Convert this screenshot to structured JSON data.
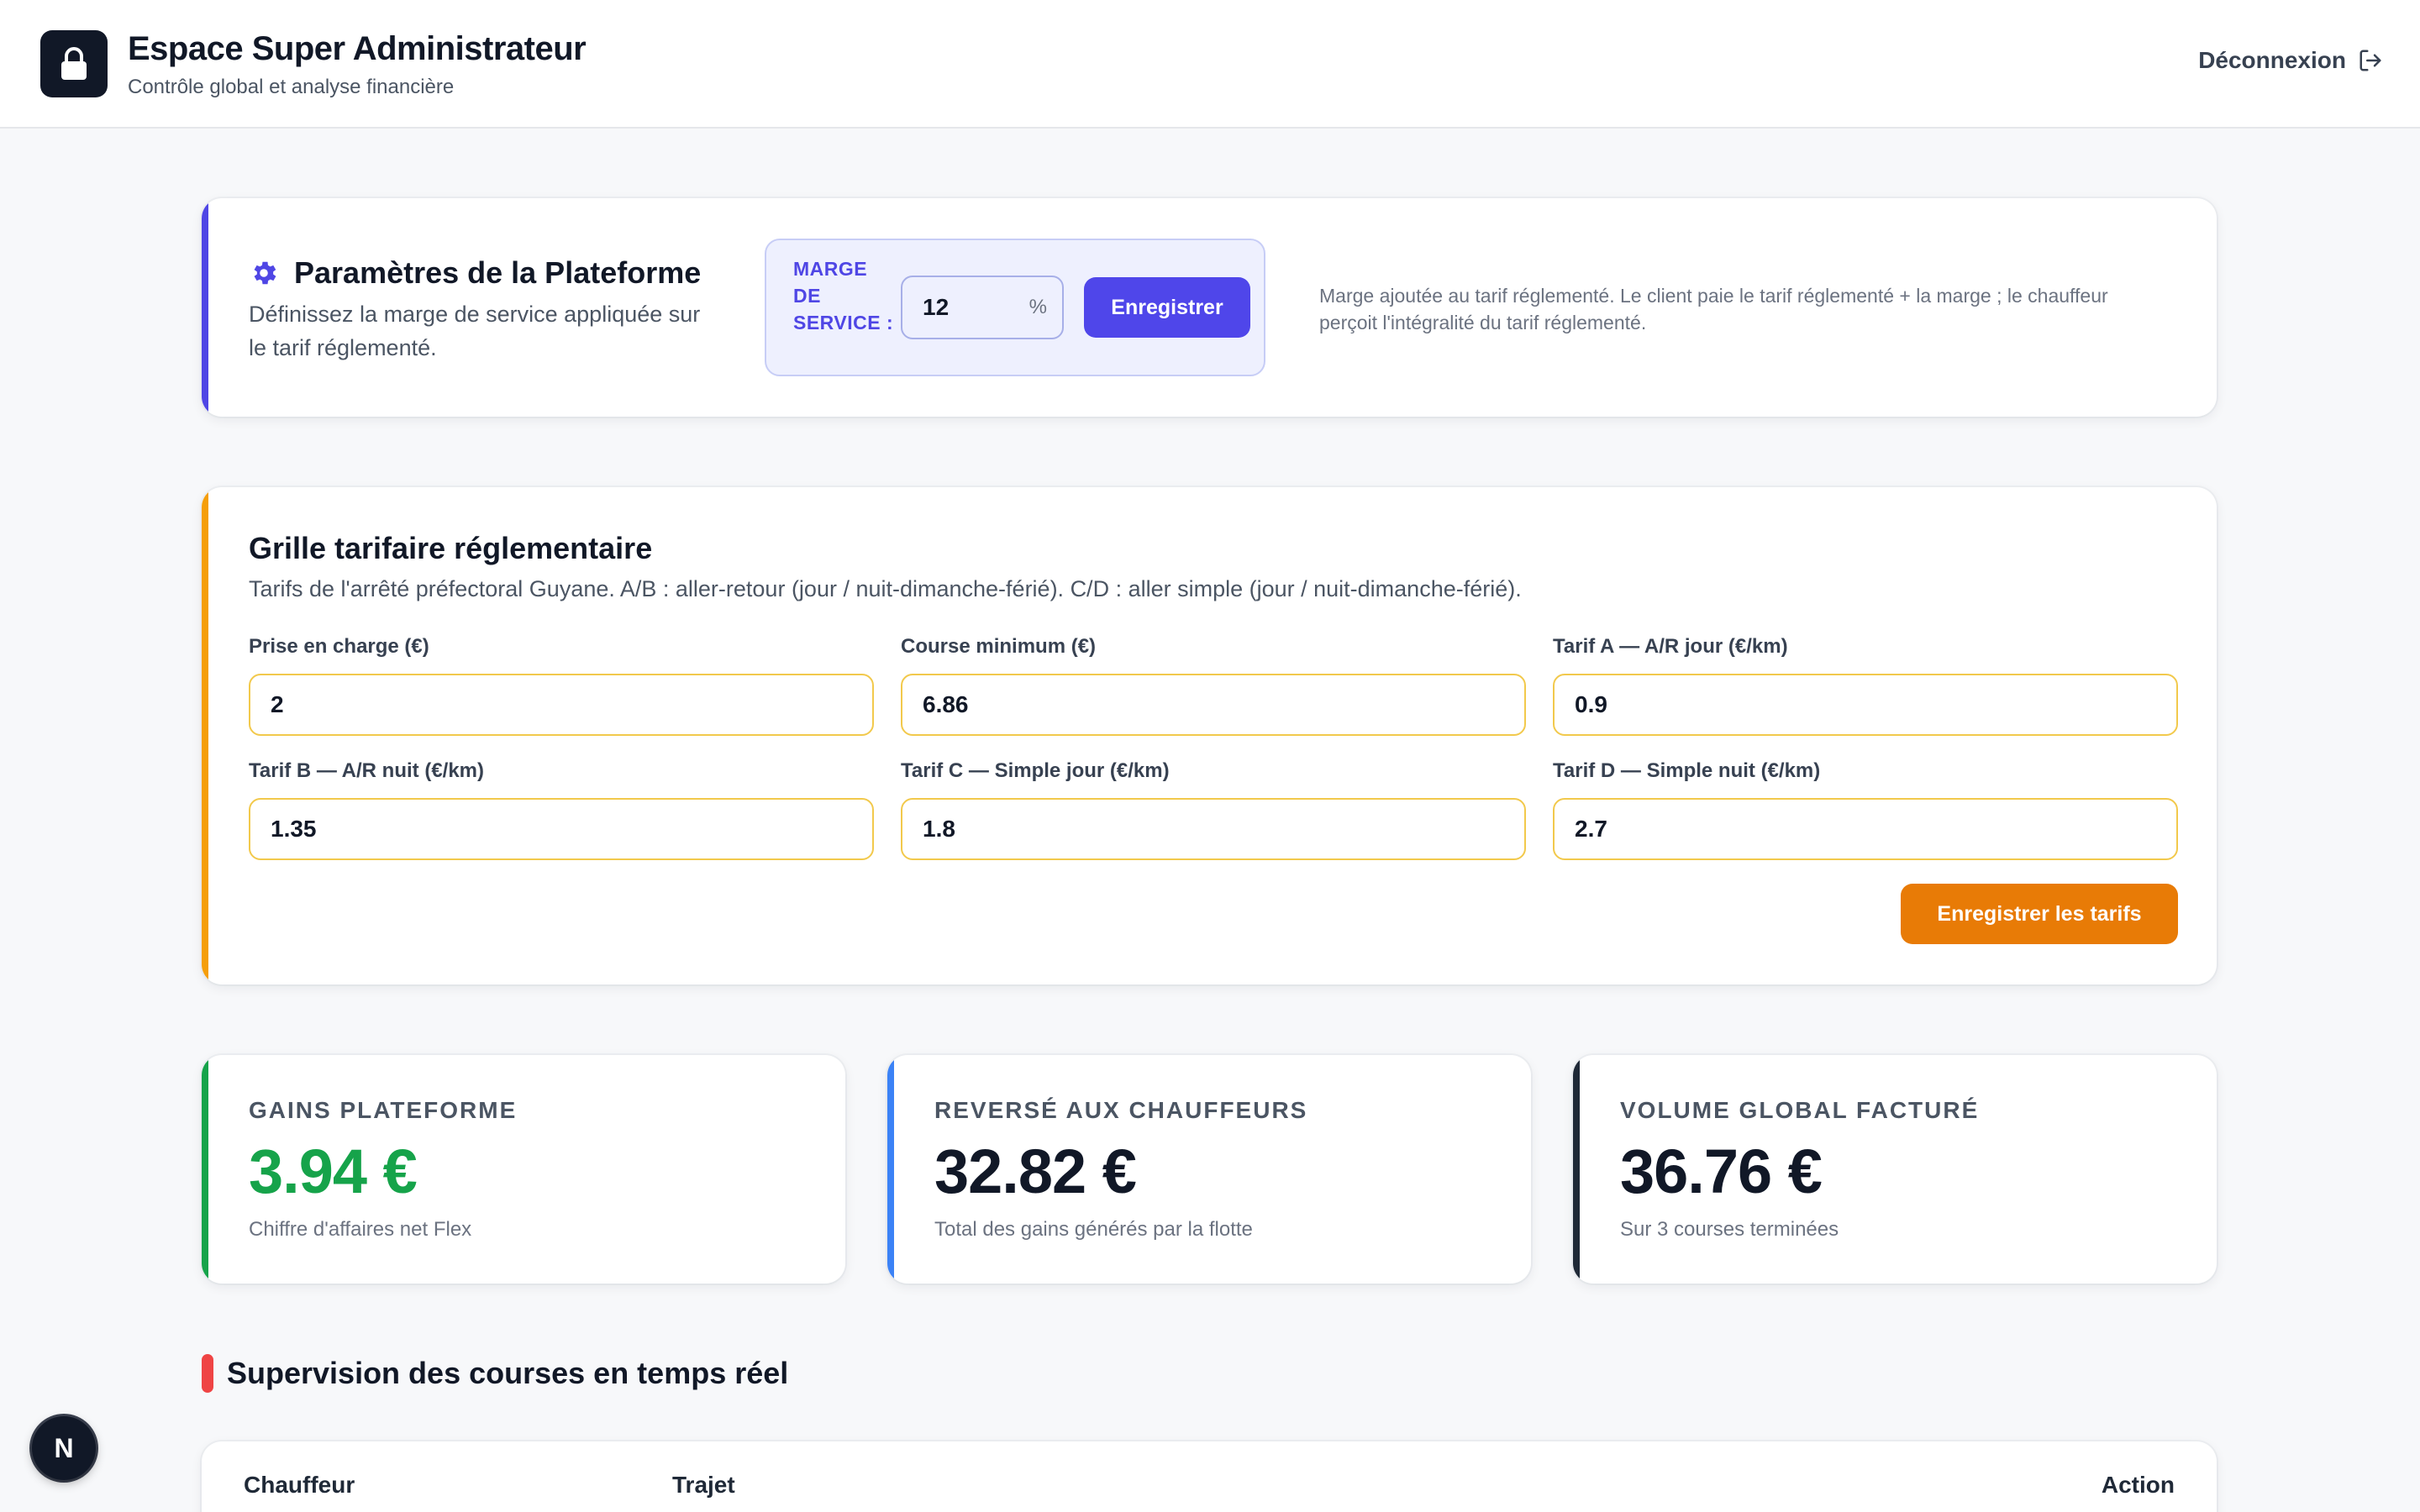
{
  "header": {
    "title": "Espace Super Administrateur",
    "subtitle": "Contrôle global et analyse financière",
    "logout_label": "Déconnexion"
  },
  "params": {
    "title": "Paramètres de la Plateforme",
    "description": "Définissez la marge de service appliquée sur le tarif réglementé.",
    "margin_label": "Marge de service :",
    "margin_value": "12",
    "margin_unit": "%",
    "save_label": "Enregistrer",
    "note": "Marge ajoutée au tarif réglementé. Le client paie le tarif réglementé + la marge ; le chauffeur perçoit l'intégralité du tarif réglementé."
  },
  "tariffs": {
    "title": "Grille tarifaire réglementaire",
    "description": "Tarifs de l'arrêté préfectoral Guyane. A/B : aller-retour (jour / nuit-dimanche-férié). C/D : aller simple (jour / nuit-dimanche-férié).",
    "fields": [
      {
        "label": "Prise en charge (€)",
        "value": "2"
      },
      {
        "label": "Course minimum (€)",
        "value": "6.86"
      },
      {
        "label": "Tarif A — A/R jour (€/km)",
        "value": "0.9"
      },
      {
        "label": "Tarif B — A/R nuit (€/km)",
        "value": "1.35"
      },
      {
        "label": "Tarif C — Simple jour (€/km)",
        "value": "1.8"
      },
      {
        "label": "Tarif D — Simple nuit (€/km)",
        "value": "2.7"
      }
    ],
    "save_label": "Enregistrer les tarifs"
  },
  "stats": [
    {
      "label": "Gains plateforme",
      "value": "3.94 €",
      "sub": "Chiffre d'affaires net Flex",
      "accent": "#16a34a",
      "value_color": "#16a34a"
    },
    {
      "label": "Reversé aux chauffeurs",
      "value": "32.82 €",
      "sub": "Total des gains générés par la flotte",
      "accent": "#3b82f6",
      "value_color": "#111827"
    },
    {
      "label": "Volume global facturé",
      "value": "36.76 €",
      "sub": "Sur 3 courses terminées",
      "accent": "#1f2937",
      "value_color": "#111827"
    }
  ],
  "supervision": {
    "title": "Supervision des courses en temps réel",
    "columns": [
      "Chauffeur",
      "Trajet",
      "Action"
    ]
  },
  "fab": {
    "label": "N"
  },
  "colors": {
    "primary": "#4f46e5",
    "tariff_accent": "#f59e0b",
    "tariff_button": "#e87b06",
    "danger": "#ef4444"
  }
}
